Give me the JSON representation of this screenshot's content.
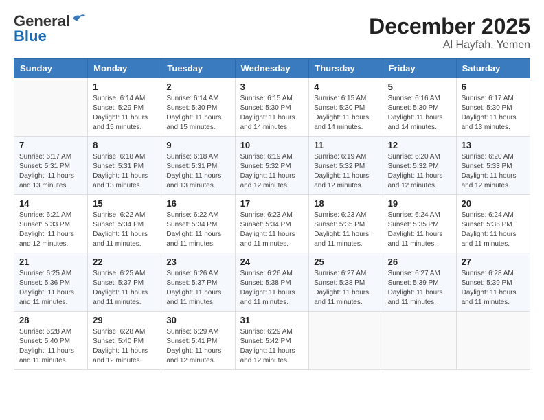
{
  "header": {
    "logo_line1": "General",
    "logo_line2": "Blue",
    "month": "December 2025",
    "location": "Al Hayfah, Yemen"
  },
  "weekdays": [
    "Sunday",
    "Monday",
    "Tuesday",
    "Wednesday",
    "Thursday",
    "Friday",
    "Saturday"
  ],
  "weeks": [
    [
      {
        "day": "",
        "sunrise": "",
        "sunset": "",
        "daylight": ""
      },
      {
        "day": "1",
        "sunrise": "Sunrise: 6:14 AM",
        "sunset": "Sunset: 5:29 PM",
        "daylight": "Daylight: 11 hours and 15 minutes."
      },
      {
        "day": "2",
        "sunrise": "Sunrise: 6:14 AM",
        "sunset": "Sunset: 5:30 PM",
        "daylight": "Daylight: 11 hours and 15 minutes."
      },
      {
        "day": "3",
        "sunrise": "Sunrise: 6:15 AM",
        "sunset": "Sunset: 5:30 PM",
        "daylight": "Daylight: 11 hours and 14 minutes."
      },
      {
        "day": "4",
        "sunrise": "Sunrise: 6:15 AM",
        "sunset": "Sunset: 5:30 PM",
        "daylight": "Daylight: 11 hours and 14 minutes."
      },
      {
        "day": "5",
        "sunrise": "Sunrise: 6:16 AM",
        "sunset": "Sunset: 5:30 PM",
        "daylight": "Daylight: 11 hours and 14 minutes."
      },
      {
        "day": "6",
        "sunrise": "Sunrise: 6:17 AM",
        "sunset": "Sunset: 5:30 PM",
        "daylight": "Daylight: 11 hours and 13 minutes."
      }
    ],
    [
      {
        "day": "7",
        "sunrise": "Sunrise: 6:17 AM",
        "sunset": "Sunset: 5:31 PM",
        "daylight": "Daylight: 11 hours and 13 minutes."
      },
      {
        "day": "8",
        "sunrise": "Sunrise: 6:18 AM",
        "sunset": "Sunset: 5:31 PM",
        "daylight": "Daylight: 11 hours and 13 minutes."
      },
      {
        "day": "9",
        "sunrise": "Sunrise: 6:18 AM",
        "sunset": "Sunset: 5:31 PM",
        "daylight": "Daylight: 11 hours and 13 minutes."
      },
      {
        "day": "10",
        "sunrise": "Sunrise: 6:19 AM",
        "sunset": "Sunset: 5:32 PM",
        "daylight": "Daylight: 11 hours and 12 minutes."
      },
      {
        "day": "11",
        "sunrise": "Sunrise: 6:19 AM",
        "sunset": "Sunset: 5:32 PM",
        "daylight": "Daylight: 11 hours and 12 minutes."
      },
      {
        "day": "12",
        "sunrise": "Sunrise: 6:20 AM",
        "sunset": "Sunset: 5:32 PM",
        "daylight": "Daylight: 11 hours and 12 minutes."
      },
      {
        "day": "13",
        "sunrise": "Sunrise: 6:20 AM",
        "sunset": "Sunset: 5:33 PM",
        "daylight": "Daylight: 11 hours and 12 minutes."
      }
    ],
    [
      {
        "day": "14",
        "sunrise": "Sunrise: 6:21 AM",
        "sunset": "Sunset: 5:33 PM",
        "daylight": "Daylight: 11 hours and 12 minutes."
      },
      {
        "day": "15",
        "sunrise": "Sunrise: 6:22 AM",
        "sunset": "Sunset: 5:34 PM",
        "daylight": "Daylight: 11 hours and 11 minutes."
      },
      {
        "day": "16",
        "sunrise": "Sunrise: 6:22 AM",
        "sunset": "Sunset: 5:34 PM",
        "daylight": "Daylight: 11 hours and 11 minutes."
      },
      {
        "day": "17",
        "sunrise": "Sunrise: 6:23 AM",
        "sunset": "Sunset: 5:34 PM",
        "daylight": "Daylight: 11 hours and 11 minutes."
      },
      {
        "day": "18",
        "sunrise": "Sunrise: 6:23 AM",
        "sunset": "Sunset: 5:35 PM",
        "daylight": "Daylight: 11 hours and 11 minutes."
      },
      {
        "day": "19",
        "sunrise": "Sunrise: 6:24 AM",
        "sunset": "Sunset: 5:35 PM",
        "daylight": "Daylight: 11 hours and 11 minutes."
      },
      {
        "day": "20",
        "sunrise": "Sunrise: 6:24 AM",
        "sunset": "Sunset: 5:36 PM",
        "daylight": "Daylight: 11 hours and 11 minutes."
      }
    ],
    [
      {
        "day": "21",
        "sunrise": "Sunrise: 6:25 AM",
        "sunset": "Sunset: 5:36 PM",
        "daylight": "Daylight: 11 hours and 11 minutes."
      },
      {
        "day": "22",
        "sunrise": "Sunrise: 6:25 AM",
        "sunset": "Sunset: 5:37 PM",
        "daylight": "Daylight: 11 hours and 11 minutes."
      },
      {
        "day": "23",
        "sunrise": "Sunrise: 6:26 AM",
        "sunset": "Sunset: 5:37 PM",
        "daylight": "Daylight: 11 hours and 11 minutes."
      },
      {
        "day": "24",
        "sunrise": "Sunrise: 6:26 AM",
        "sunset": "Sunset: 5:38 PM",
        "daylight": "Daylight: 11 hours and 11 minutes."
      },
      {
        "day": "25",
        "sunrise": "Sunrise: 6:27 AM",
        "sunset": "Sunset: 5:38 PM",
        "daylight": "Daylight: 11 hours and 11 minutes."
      },
      {
        "day": "26",
        "sunrise": "Sunrise: 6:27 AM",
        "sunset": "Sunset: 5:39 PM",
        "daylight": "Daylight: 11 hours and 11 minutes."
      },
      {
        "day": "27",
        "sunrise": "Sunrise: 6:28 AM",
        "sunset": "Sunset: 5:39 PM",
        "daylight": "Daylight: 11 hours and 11 minutes."
      }
    ],
    [
      {
        "day": "28",
        "sunrise": "Sunrise: 6:28 AM",
        "sunset": "Sunset: 5:40 PM",
        "daylight": "Daylight: 11 hours and 11 minutes."
      },
      {
        "day": "29",
        "sunrise": "Sunrise: 6:28 AM",
        "sunset": "Sunset: 5:40 PM",
        "daylight": "Daylight: 11 hours and 12 minutes."
      },
      {
        "day": "30",
        "sunrise": "Sunrise: 6:29 AM",
        "sunset": "Sunset: 5:41 PM",
        "daylight": "Daylight: 11 hours and 12 minutes."
      },
      {
        "day": "31",
        "sunrise": "Sunrise: 6:29 AM",
        "sunset": "Sunset: 5:42 PM",
        "daylight": "Daylight: 11 hours and 12 minutes."
      },
      {
        "day": "",
        "sunrise": "",
        "sunset": "",
        "daylight": ""
      },
      {
        "day": "",
        "sunrise": "",
        "sunset": "",
        "daylight": ""
      },
      {
        "day": "",
        "sunrise": "",
        "sunset": "",
        "daylight": ""
      }
    ]
  ]
}
